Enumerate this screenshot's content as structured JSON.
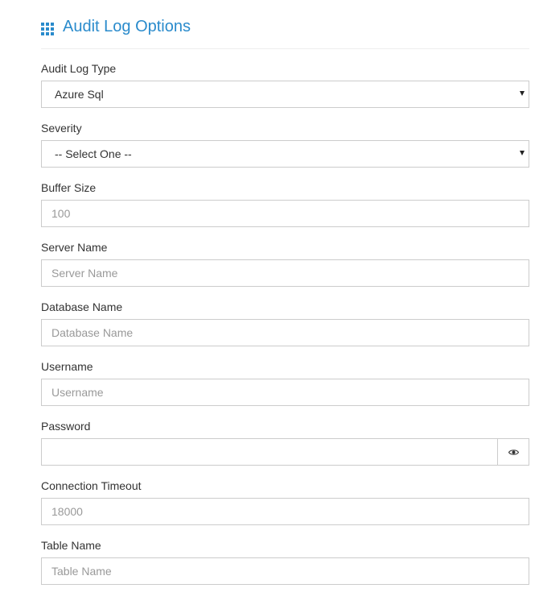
{
  "header": {
    "icon": "grid-icon",
    "title": "Audit Log Options",
    "accent_color": "#2a8bcc"
  },
  "fields": {
    "audit_log_type": {
      "label": "Audit Log Type",
      "value": "Azure Sql"
    },
    "severity": {
      "label": "Severity",
      "value": "-- Select One --"
    },
    "buffer_size": {
      "label": "Buffer Size",
      "placeholder": "100"
    },
    "server_name": {
      "label": "Server Name",
      "placeholder": "Server Name"
    },
    "database_name": {
      "label": "Database Name",
      "placeholder": "Database Name"
    },
    "username": {
      "label": "Username",
      "placeholder": "Username"
    },
    "password": {
      "label": "Password",
      "value": "",
      "toggle_icon": "eye-icon"
    },
    "connection_timeout": {
      "label": "Connection Timeout",
      "placeholder": "18000"
    },
    "table_name": {
      "label": "Table Name",
      "placeholder": "Table Name"
    }
  }
}
